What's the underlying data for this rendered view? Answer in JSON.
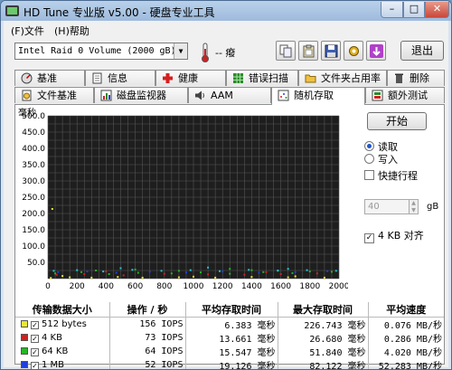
{
  "window": {
    "title": "HD Tune 专业版 v5.00 - 硬盘专业工具",
    "minimize": "–",
    "maximize": "□",
    "close": "✕"
  },
  "menu": {
    "file": "(F)文件",
    "help": "(H)帮助"
  },
  "toolbar": {
    "drive": "Intel   Raid 0 Volume (2000 gB)",
    "temperature": "-- 癈",
    "exit_label": "退出"
  },
  "tabs_top": [
    "基准",
    "信息",
    "健康",
    "错误扫描",
    "文件夹占用率",
    "删除"
  ],
  "tabs_bottom": [
    "文件基准",
    "磁盘监视器",
    "AAM",
    "随机存取",
    "额外测试"
  ],
  "active_tab": "随机存取",
  "controls": {
    "start_label": "开始",
    "read_label": "读取",
    "write_label": "写入",
    "quick_stroke_label": "快捷行程",
    "quick_stroke_value": "40",
    "quick_stroke_unit": "gB",
    "align_label": "4 KB 对齐",
    "check_mark": "✓"
  },
  "chart_data": {
    "type": "scatter",
    "ylabel": "毫秒",
    "xlabel": "",
    "x_tick_labels": [
      "0",
      "200",
      "400",
      "600",
      "800",
      "1000",
      "1200",
      "1400",
      "1600",
      "1800",
      "2000gB"
    ],
    "y_tick_labels": [
      "500.0",
      "450.0",
      "400.0",
      "350.0",
      "300.0",
      "250.0",
      "200.0",
      "150.0",
      "100.0",
      "50.0",
      ""
    ],
    "xlim": [
      0,
      2000
    ],
    "ylim": [
      0,
      500
    ],
    "grid": true,
    "series": [
      {
        "name": "512 bytes",
        "color": "#e8e832",
        "points": [
          [
            20,
            2
          ],
          [
            150,
            4
          ],
          [
            300,
            3
          ],
          [
            480,
            5
          ],
          [
            650,
            3
          ],
          [
            900,
            4
          ],
          [
            1150,
            3
          ],
          [
            1400,
            5
          ],
          [
            1650,
            4
          ],
          [
            1900,
            3
          ],
          [
            100,
            8
          ],
          [
            1000,
            6
          ],
          [
            1700,
            7
          ],
          [
            30,
            214
          ]
        ]
      },
      {
        "name": "4 KB",
        "color": "#d02020",
        "points": [
          [
            60,
            12
          ],
          [
            250,
            14
          ],
          [
            520,
            10
          ],
          [
            800,
            15
          ],
          [
            1100,
            13
          ],
          [
            1350,
            12
          ],
          [
            1600,
            14
          ],
          [
            1850,
            16
          ],
          [
            400,
            22
          ],
          [
            1500,
            20
          ]
        ]
      },
      {
        "name": "64 KB",
        "color": "#22b822",
        "points": [
          [
            50,
            16
          ],
          [
            230,
            20
          ],
          [
            420,
            14
          ],
          [
            620,
            18
          ],
          [
            850,
            16
          ],
          [
            1050,
            19
          ],
          [
            1250,
            15
          ],
          [
            1480,
            20
          ],
          [
            1680,
            17
          ],
          [
            1950,
            21
          ],
          [
            330,
            25
          ],
          [
            900,
            24
          ],
          [
            1400,
            26
          ],
          [
            1800,
            22
          ],
          [
            600,
            28
          ],
          [
            1250,
            30
          ],
          [
            1580,
            24
          ]
        ]
      },
      {
        "name": "1 MB",
        "color": "#2040d8",
        "points": [
          [
            70,
            20
          ],
          [
            270,
            22
          ],
          [
            470,
            18
          ],
          [
            700,
            21
          ],
          [
            950,
            19
          ],
          [
            1200,
            22
          ],
          [
            1450,
            18
          ],
          [
            1700,
            20
          ],
          [
            1920,
            23
          ]
        ]
      },
      {
        "name": "随机",
        "color": "#20c8d8",
        "points": [
          [
            40,
            24
          ],
          [
            200,
            26
          ],
          [
            380,
            22
          ],
          [
            580,
            27
          ],
          [
            780,
            24
          ],
          [
            980,
            26
          ],
          [
            1180,
            23
          ],
          [
            1380,
            27
          ],
          [
            1580,
            25
          ],
          [
            1780,
            26
          ],
          [
            1980,
            24
          ],
          [
            500,
            32
          ],
          [
            1100,
            34
          ],
          [
            1650,
            30
          ]
        ]
      }
    ]
  },
  "results": {
    "headers": [
      "传输数据大小",
      "操作 / 秒",
      "平均存取时间",
      "最大存取时间",
      "平均速度"
    ],
    "rows": [
      {
        "name": "512 bytes",
        "color": "#e8e832",
        "ops": "156 IOPS",
        "avg": "6.383 毫秒",
        "max": "226.743 毫秒",
        "speed": "0.076 MB/秒"
      },
      {
        "name": "4 KB",
        "color": "#d02020",
        "ops": "73 IOPS",
        "avg": "13.661 毫秒",
        "max": "26.680 毫秒",
        "speed": "0.286 MB/秒"
      },
      {
        "name": "64 KB",
        "color": "#22b822",
        "ops": "64 IOPS",
        "avg": "15.547 毫秒",
        "max": "51.840 毫秒",
        "speed": "4.020 MB/秒"
      },
      {
        "name": "1 MB",
        "color": "#2040d8",
        "ops": "52 IOPS",
        "avg": "19.126 毫秒",
        "max": "82.122 毫秒",
        "speed": "52.283 MB/秒"
      },
      {
        "name": "随机",
        "color": "#20c8d8",
        "ops": "51 IOPS",
        "avg": "19.475 毫秒",
        "max": "118.147 毫秒",
        "speed": "26.053 MB/秒"
      }
    ]
  }
}
